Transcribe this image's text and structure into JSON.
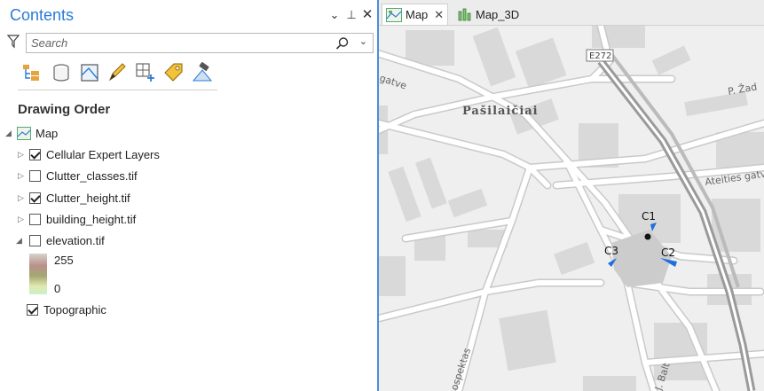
{
  "contents": {
    "title": "Contents",
    "search_placeholder": "Search",
    "section_title": "Drawing Order",
    "root_layer": "Map",
    "layers": [
      {
        "label": "Cellular Expert Layers",
        "checked": true
      },
      {
        "label": "Clutter_classes.tif",
        "checked": false
      },
      {
        "label": "Clutter_height.tif",
        "checked": true
      },
      {
        "label": "building_height.tif",
        "checked": false
      },
      {
        "label": "elevation.tif",
        "checked": false
      }
    ],
    "legend": {
      "max": "255",
      "min": "0"
    },
    "basemap": {
      "label": "Topographic",
      "checked": true
    }
  },
  "tabs": [
    {
      "label": "Map",
      "active": true
    },
    {
      "label": "Map_3D",
      "active": false
    }
  ],
  "map": {
    "district_label": "Pašilaičiai",
    "road_labels": [
      "E272",
      "gatve",
      "P. Žad",
      "Ateities gatvė",
      "ospektas",
      "J. Balt"
    ],
    "site_labels": [
      "C1",
      "C2",
      "C3"
    ],
    "colors": {
      "road_fill": "#ffffff",
      "road_edge": "#c9c9c9",
      "block": "#d9d9d9",
      "background": "#efefef",
      "highway": "#9a9a9a",
      "sector": "#1e6fe0"
    }
  }
}
